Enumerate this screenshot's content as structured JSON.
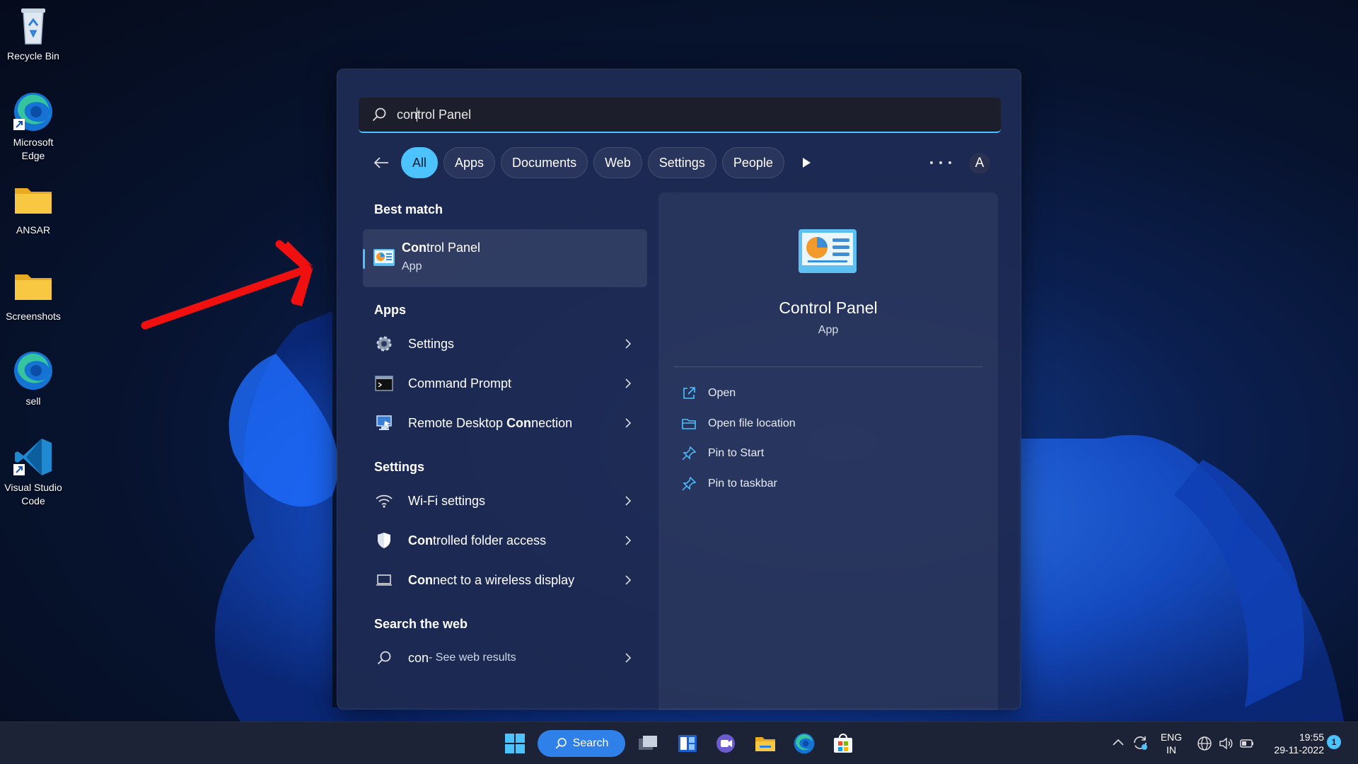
{
  "desktop": {
    "icons": [
      {
        "label": "Recycle Bin",
        "icon": "recycle-bin-icon"
      },
      {
        "label": "Microsoft Edge",
        "icon": "edge-icon"
      },
      {
        "label": "ANSAR",
        "icon": "folder-icon"
      },
      {
        "label": "Screenshots",
        "icon": "folder-icon"
      },
      {
        "label": "sell",
        "icon": "edge-icon"
      },
      {
        "label": "Visual Studio Code",
        "icon": "vscode-icon"
      }
    ]
  },
  "search": {
    "query_before_caret": "con",
    "query_after_caret": "trol Panel"
  },
  "filters": {
    "items": [
      "All",
      "Apps",
      "Documents",
      "Web",
      "Settings",
      "People"
    ],
    "active": "All",
    "avatar": "A"
  },
  "results": {
    "best_match_title": "Best match",
    "best_match": {
      "name_bold": "Con",
      "name_rest": "trol Panel",
      "type": "App"
    },
    "apps_title": "Apps",
    "apps": [
      {
        "name": "Settings",
        "icon": "gear-icon"
      },
      {
        "name": "Command Prompt",
        "icon": "terminal-icon"
      },
      {
        "name_pre": "Remote Desktop ",
        "name_bold": "Con",
        "name_post": "nection",
        "icon": "remote-desktop-icon"
      }
    ],
    "settings_title": "Settings",
    "settings": [
      {
        "name": "Wi-Fi settings",
        "icon": "wifi-icon"
      },
      {
        "name_bold": "Con",
        "name_post": "trolled folder access",
        "icon": "shield-icon"
      },
      {
        "name_bold": "Con",
        "name_post": "nect to a wireless display",
        "icon": "display-icon"
      }
    ],
    "web_title": "Search the web",
    "web": {
      "query": "con",
      "suffix": " - See web results"
    }
  },
  "preview": {
    "title": "Control Panel",
    "subtitle": "App",
    "actions": [
      {
        "label": "Open",
        "icon": "open-external-icon"
      },
      {
        "label": "Open file location",
        "icon": "folder-outline-icon"
      },
      {
        "label": "Pin to Start",
        "icon": "pin-icon"
      },
      {
        "label": "Pin to taskbar",
        "icon": "pin-icon"
      }
    ]
  },
  "taskbar": {
    "search_label": "Search",
    "lang_line1": "ENG",
    "lang_line2": "IN",
    "time": "19:55",
    "date": "29-11-2022",
    "notification_count": "1"
  },
  "colors": {
    "accent": "#4cc2ff",
    "panel": "#1e2b54",
    "annotation_arrow": "#f01010"
  }
}
